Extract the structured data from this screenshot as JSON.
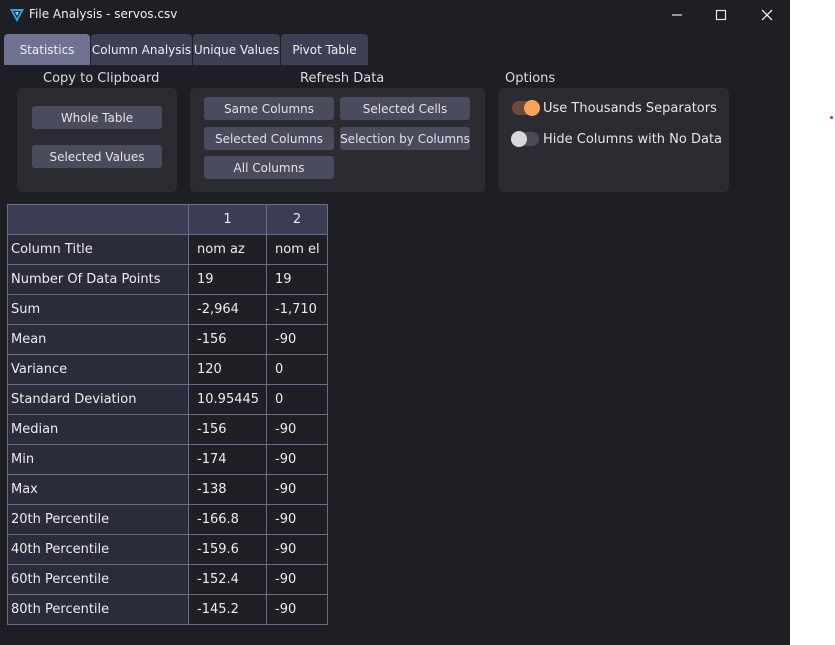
{
  "window": {
    "title": "File Analysis - servos.csv"
  },
  "colors": {
    "background": "#1e1f24",
    "panel": "#2b2c32",
    "tab_active": "#6f7290",
    "tab_inactive": "#3d3f52",
    "toggle_on": "#f5a35c",
    "grid": "#6a6c88",
    "red_dot": "#e03030"
  },
  "tabs": [
    {
      "label": "Statistics",
      "active": true
    },
    {
      "label": "Column Analysis",
      "active": false
    },
    {
      "label": "Unique Values",
      "active": false
    },
    {
      "label": "Pivot Table",
      "active": false
    }
  ],
  "copy_group": {
    "title": "Copy to Clipboard",
    "buttons": [
      "Whole Table",
      "Selected Values"
    ]
  },
  "refresh_group": {
    "title": "Refresh Data",
    "buttons": [
      "Same Columns",
      "Selected Cells",
      "Selected Columns",
      "Selection by Columns",
      "All Columns"
    ]
  },
  "options_group": {
    "title": "Options",
    "toggles": [
      {
        "label": "Use Thousands Separators",
        "on": true
      },
      {
        "label": "Hide Columns with No Data",
        "on": false
      }
    ]
  },
  "table": {
    "columns": [
      "1",
      "2"
    ],
    "rows": [
      {
        "label": "Column Title",
        "values": [
          "nom az",
          "nom el"
        ]
      },
      {
        "label": "Number Of Data Points",
        "values": [
          "19",
          "19"
        ]
      },
      {
        "label": "Sum",
        "values": [
          "-2,964",
          "-1,710"
        ]
      },
      {
        "label": "Mean",
        "values": [
          "-156",
          "-90"
        ]
      },
      {
        "label": "Variance",
        "values": [
          "120",
          "0"
        ]
      },
      {
        "label": "Standard Deviation",
        "values": [
          "10.95445",
          "0"
        ]
      },
      {
        "label": "Median",
        "values": [
          "-156",
          "-90"
        ]
      },
      {
        "label": "Min",
        "values": [
          "-174",
          "-90"
        ]
      },
      {
        "label": "Max",
        "values": [
          "-138",
          "-90"
        ]
      },
      {
        "label": "20th Percentile",
        "values": [
          "-166.8",
          "-90"
        ]
      },
      {
        "label": "40th Percentile",
        "values": [
          "-159.6",
          "-90"
        ]
      },
      {
        "label": "60th Percentile",
        "values": [
          "-152.4",
          "-90"
        ]
      },
      {
        "label": "80th Percentile",
        "values": [
          "-145.2",
          "-90"
        ]
      }
    ]
  }
}
